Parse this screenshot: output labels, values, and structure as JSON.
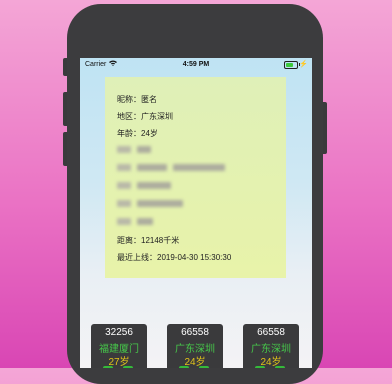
{
  "status_bar": {
    "carrier": "Carrier",
    "time": "4:59 PM",
    "battery_level": 0.7
  },
  "profile": {
    "nickname": "昵称：匿名",
    "region": "地区：广东深圳",
    "age": "年龄：24岁",
    "distance": "距离：12148千米",
    "last_online": "最近上线：2019-04-30 15:30:30"
  },
  "users": [
    {
      "id": "32256",
      "region": "福建厦门",
      "age": "27岁"
    },
    {
      "id": "66558",
      "region": "广东深圳",
      "age": "24岁"
    },
    {
      "id": "66558",
      "region": "广东深圳",
      "age": "24岁"
    }
  ],
  "colors": {
    "card_bg": "#e8f3a9",
    "region_text": "#46c84a",
    "age_text": "#e0c21a"
  }
}
